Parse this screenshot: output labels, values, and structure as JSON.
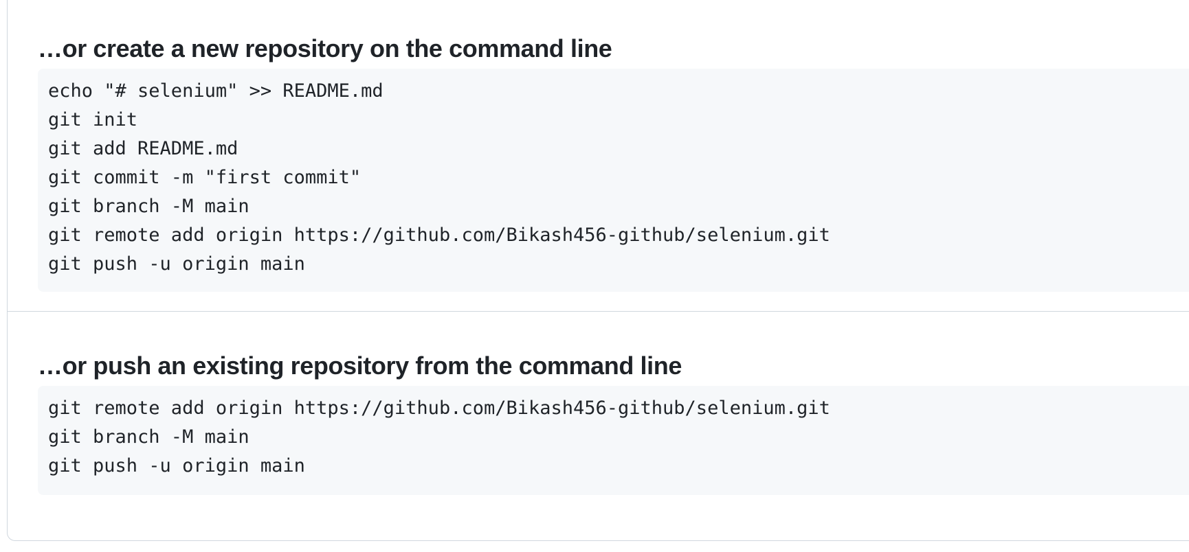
{
  "create_section": {
    "heading": "…or create a new repository on the command line",
    "lines": [
      "echo \"# selenium\" >> README.md",
      "git init",
      "git add README.md",
      "git commit -m \"first commit\"",
      "git branch -M main",
      "git remote add origin https://github.com/Bikash456-github/selenium.git",
      "git push -u origin main"
    ]
  },
  "push_section": {
    "heading": "…or push an existing repository from the command line",
    "lines": [
      "git remote add origin https://github.com/Bikash456-github/selenium.git",
      "git branch -M main",
      "git push -u origin main"
    ]
  }
}
